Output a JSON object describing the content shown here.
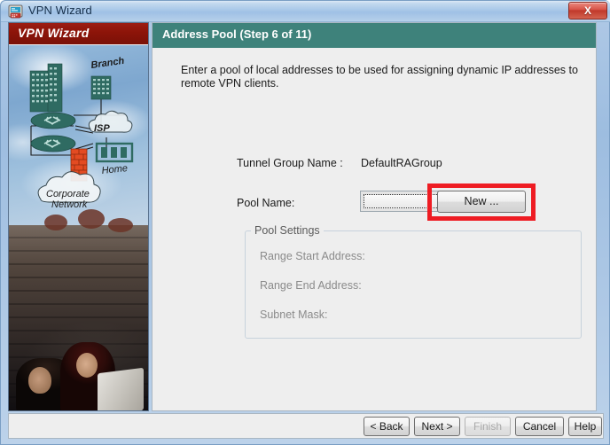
{
  "window": {
    "title": "VPN Wizard",
    "icon": "vpn-wizard-icon",
    "close_label": "X"
  },
  "sidebar": {
    "banner_title": "VPN Wizard",
    "diagram": {
      "labels": [
        "Branch",
        "ISP",
        "Home",
        "Corporate Network"
      ],
      "node_color": "#2f6b62"
    }
  },
  "content": {
    "step_title": "Address Pool  (Step 6 of 11)",
    "header_color": "#3e827b",
    "intro": "Enter a pool of local addresses to be used for assigning dynamic IP addresses to remote VPN clients.",
    "tunnel_group": {
      "label": "Tunnel Group Name :",
      "value": "DefaultRAGroup"
    },
    "pool_name": {
      "label": "Pool Name:",
      "value": "",
      "placeholder": "",
      "options": []
    },
    "new_button": {
      "label": "New ...",
      "highlight_color": "#ee1c23"
    },
    "pool_settings": {
      "title": "Pool Settings",
      "fields": [
        {
          "label": "Range Start Address:",
          "value": ""
        },
        {
          "label": "Range End Address:",
          "value": ""
        },
        {
          "label": "Subnet Mask:",
          "value": ""
        }
      ]
    }
  },
  "buttons": {
    "back": "< Back",
    "next": "Next >",
    "finish": "Finish",
    "cancel": "Cancel",
    "help": "Help"
  }
}
